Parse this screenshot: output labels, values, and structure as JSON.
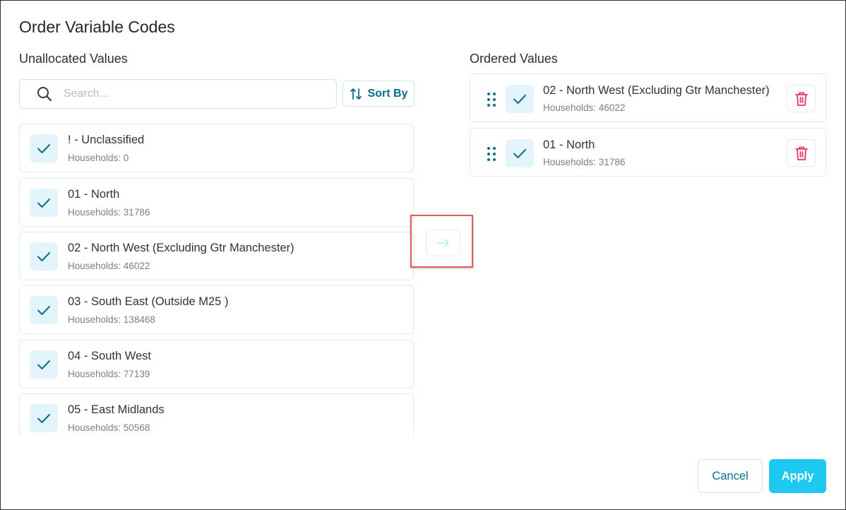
{
  "dialog": {
    "title": "Order Variable Codes",
    "cancel_label": "Cancel",
    "apply_label": "Apply"
  },
  "unallocated": {
    "heading": "Unallocated Values",
    "search_placeholder": "Search...",
    "sort_label": "Sort By",
    "items": [
      {
        "name": "! - Unclassified",
        "sub": "Households: 0",
        "checked": true
      },
      {
        "name": "01 - North",
        "sub": "Households: 31786",
        "checked": true
      },
      {
        "name": "02 - North West (Excluding Gtr Manchester)",
        "sub": "Households: 46022",
        "checked": true
      },
      {
        "name": "03 - South East (Outside M25 )",
        "sub": "Households: 138468",
        "checked": true
      },
      {
        "name": "04 - South West",
        "sub": "Households: 77139",
        "checked": true
      },
      {
        "name": "05 - East Midlands",
        "sub": "Households: 50568",
        "checked": true
      }
    ]
  },
  "ordered": {
    "heading": "Ordered Values",
    "items": [
      {
        "name": "02 - North West (Excluding Gtr Manchester)",
        "sub": "Households: 46022",
        "checked": true
      },
      {
        "name": "01 - North",
        "sub": "Households: 31786",
        "checked": true
      }
    ]
  },
  "colors": {
    "accent": "#0c6d8a",
    "apply": "#1ec8f1",
    "check_bg": "#e3f5fb",
    "delete": "#e8345f",
    "highlight": "#e25b5b"
  },
  "icons": {
    "search": "search-icon",
    "sort": "sort-arrows-icon",
    "check": "check-icon",
    "move": "arrow-right-icon",
    "drag": "drag-handle-icon",
    "delete": "trash-icon"
  }
}
